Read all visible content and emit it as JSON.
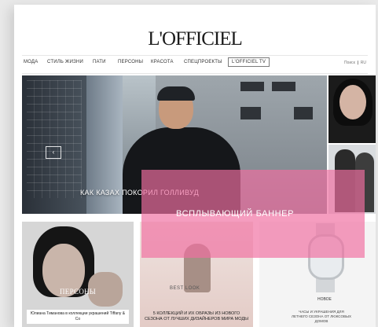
{
  "logo": "L'OFFICIEL",
  "nav": {
    "items": [
      "МОДА",
      "СТИЛЬ ЖИЗНИ",
      "ПАТИ",
      "ПЕРСОНЫ",
      "КРАСОТА",
      "СПЕЦПРОЕКТЫ"
    ],
    "tv": "L'OFFICIEL TV",
    "right": "Поиск  ❙  RU"
  },
  "hero": {
    "caption": "КАК КАЗАХ ПОКОРИЛ ГОЛЛИВУД",
    "arrow": "‹"
  },
  "cards": [
    {
      "label": "ПЕРСОНЫ",
      "text": "Юлиана Тиманова в коллекции украшений Tiffany & Co"
    },
    {
      "label": "BEST LOOK",
      "text": "5 КОЛЛЕКЦИЙ И ИХ ОБРАЗЫ ИЗ НОВОГО СЕЗОНА ОТ ЛУЧШИХ ДИЗАЙНЕРОВ МИРА МОДЫ"
    },
    {
      "label": "НОВОЕ",
      "text": "ЧАСЫ И УКРАШЕНИЯ ДЛЯ ЛЕТНЕГО СЕЗОНА ОТ ЛЮКСОВЫХ ДОМОВ"
    }
  ],
  "banner": {
    "text": "ВСПЛЫВАЮЩИЙ БАННЕР",
    "color": "#f06ea0"
  }
}
